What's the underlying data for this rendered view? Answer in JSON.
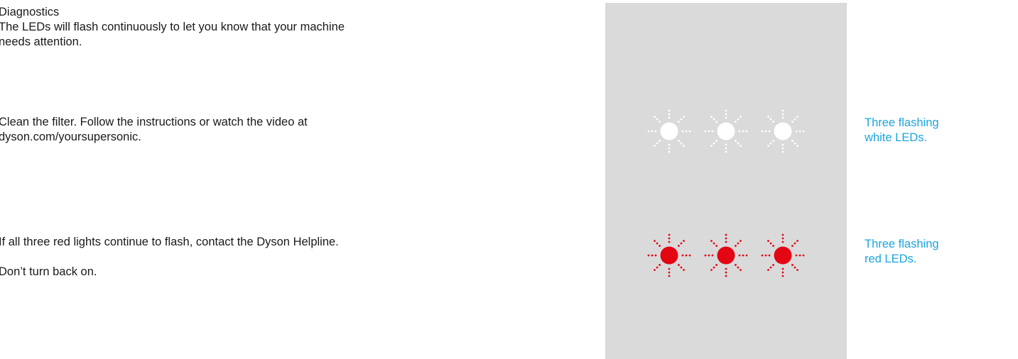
{
  "diagnostics": {
    "heading": "Diagnostics",
    "intro": "The LEDs will flash continuously to let you know that your machine\nneeds attention.",
    "filter_instruction": "Clean the filter. Follow the instructions or watch the video at\ndyson.com/yoursupersonic.",
    "red_instruction": "If all three red lights continue to flash, contact the Dyson Helpline.",
    "warning": "Don’t turn back on."
  },
  "indicators": [
    {
      "caption": "Three flashing\nwhite LEDs.",
      "led_color": "#ffffff",
      "led_count": 3
    },
    {
      "caption": "Three flashing\nred LEDs.",
      "led_color": "#e30613",
      "led_count": 3
    }
  ],
  "colors": {
    "panel_background": "#dadada",
    "caption_text": "#1ba4dd",
    "body_text": "#1a1a1a"
  }
}
